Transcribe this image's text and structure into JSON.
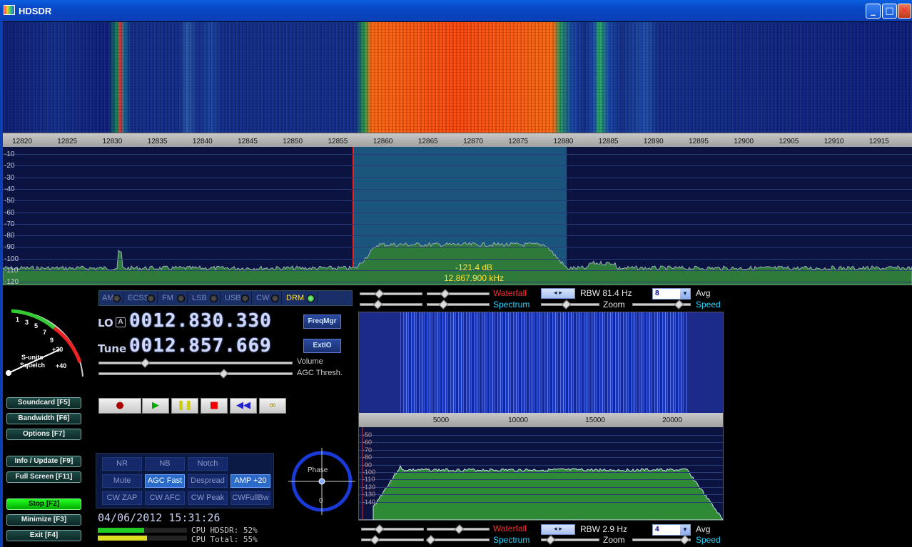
{
  "window": {
    "title": "HDSDR",
    "minimize": "_",
    "maximize": "□",
    "close": "✕"
  },
  "freq_axis": [
    "12820",
    "12825",
    "12830",
    "12835",
    "12840",
    "12845",
    "12850",
    "12855",
    "12860",
    "12865",
    "12870",
    "12875",
    "12880",
    "12885",
    "12890",
    "12895",
    "12900",
    "12905",
    "12910",
    "12915"
  ],
  "db_axis": [
    "-10",
    "-20",
    "-30",
    "-40",
    "-50",
    "-60",
    "-70",
    "-80",
    "-90",
    "-100",
    "-110",
    "-120"
  ],
  "readout": {
    "level": "-121.4 dB",
    "freq": "12,867.900 kHz"
  },
  "modes": [
    {
      "label": "AM",
      "active": false
    },
    {
      "label": "ECSS",
      "active": false
    },
    {
      "label": "FM",
      "active": false
    },
    {
      "label": "LSB",
      "active": false
    },
    {
      "label": "USB",
      "active": false
    },
    {
      "label": "CW",
      "active": false
    },
    {
      "label": "DRM",
      "active": true
    }
  ],
  "lo": {
    "label": "LO",
    "badge": "A",
    "value": "0012.830.330"
  },
  "tune": {
    "label": "Tune",
    "value": "0012.857.669"
  },
  "buttons": {
    "freqmgr": "FreqMgr",
    "extio": "ExtIO"
  },
  "sliders": {
    "volume": "Volume",
    "agc": "AGC Thresh."
  },
  "smeter": {
    "label1": "S-units",
    "label2": "Squelch",
    "ticks": [
      "1",
      "3",
      "5",
      "7",
      "9",
      "+20",
      "+40"
    ]
  },
  "transport": [
    "●",
    "▶",
    "❚❚",
    "■",
    "◀◀",
    "∞"
  ],
  "side": [
    {
      "label": "Soundcard  [F5]"
    },
    {
      "label": "Bandwidth  [F6]"
    },
    {
      "label": "Options   [F7]"
    },
    {
      "label": "Info / Update  [F9]"
    },
    {
      "label": "Full Screen  [F11]"
    },
    {
      "label": "Stop        [F2]",
      "green": true
    },
    {
      "label": "Minimize  [F3]"
    },
    {
      "label": "Exit      [F4]"
    }
  ],
  "dsp": [
    {
      "label": "NR",
      "on": false
    },
    {
      "label": "NB",
      "on": false
    },
    {
      "label": "Notch",
      "on": false
    },
    {
      "label": "Mute",
      "on": false
    },
    {
      "label": "AGC Fast",
      "on": true
    },
    {
      "label": "Despread",
      "on": false
    },
    {
      "label": "AMP +20",
      "on": true
    },
    {
      "label": "CW ZAP",
      "on": false
    },
    {
      "label": "CW AFC",
      "on": false
    },
    {
      "label": "CW Peak",
      "on": false
    },
    {
      "label": "CWFullBw",
      "on": false
    }
  ],
  "phase": {
    "label": "Phase",
    "zero": "0"
  },
  "datetime": "04/06/2012 15:31:26",
  "cpu": {
    "hdsdr": "CPU HDSDR:  52%",
    "total": "CPU Total:  55%",
    "hdsdr_pct": 0.52,
    "total_pct": 0.55
  },
  "rf_ctrl": {
    "waterfall": "Waterfall",
    "spectrum": "Spectrum",
    "rbw": "RBW 81.4 Hz",
    "avg_val": "8",
    "avg": "Avg",
    "zoom": "Zoom",
    "speed": "Speed"
  },
  "af_ctrl": {
    "waterfall": "Waterfall",
    "spectrum": "Spectrum",
    "rbw": "RBW  2.9 Hz",
    "avg_val": "4",
    "avg": "Avg",
    "zoom": "Zoom",
    "speed": "Speed"
  },
  "audio_axis": [
    "5000",
    "10000",
    "15000",
    "20000"
  ],
  "audio_db": [
    "-50",
    "-60",
    "-70",
    "-80",
    "-90",
    "-100",
    "-110",
    "-120",
    "-130",
    "-140"
  ],
  "colors": {
    "accent_yellow": "#ffe23a",
    "spectrum_fill": "#2e7a3a",
    "passband": "#2378a0"
  }
}
